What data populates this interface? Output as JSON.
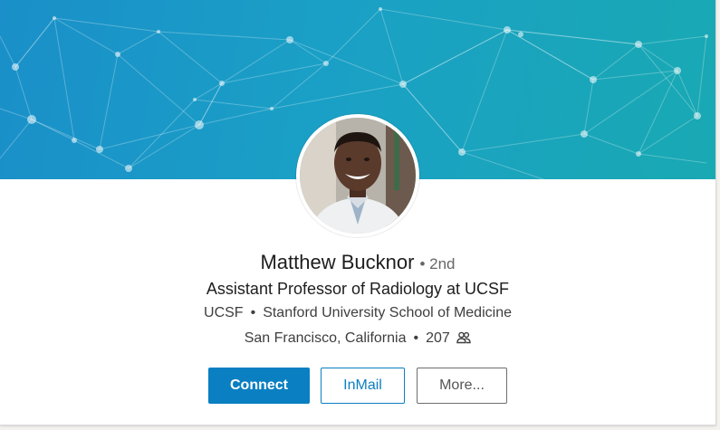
{
  "profile": {
    "name": "Matthew Bucknor",
    "degree": "2nd",
    "headline": "Assistant Professor of Radiology at UCSF",
    "organizations": [
      "UCSF",
      "Stanford University School of Medicine"
    ],
    "location": "San Francisco, California",
    "connections": "207"
  },
  "actions": {
    "connect_label": "Connect",
    "inmail_label": "InMail",
    "more_label": "More..."
  },
  "icons": {
    "connections": "people-icon"
  },
  "colors": {
    "primary": "#0a7fc2",
    "banner_start": "#1a8fc9",
    "banner_end": "#19a9b3"
  }
}
